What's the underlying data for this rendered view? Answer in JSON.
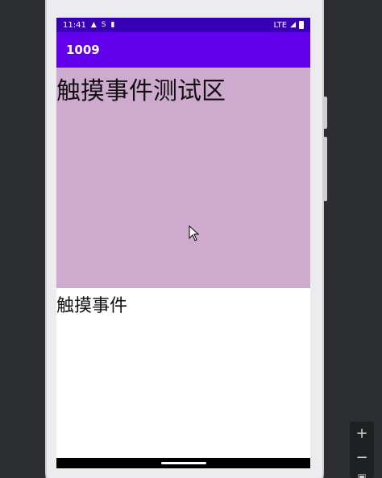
{
  "status_bar": {
    "time": "11:41",
    "network": "LTE",
    "icons": [
      "notification-a-icon",
      "notification-s-icon",
      "sd-card-icon",
      "signal-icon",
      "battery-icon"
    ]
  },
  "app_bar": {
    "title": "1009"
  },
  "touch_area": {
    "label": "触摸事件测试区",
    "background": "#ceabce"
  },
  "event_text": {
    "label": "触摸事件"
  },
  "colors": {
    "status_bar": "#3700b3",
    "app_bar": "#6200ee"
  },
  "emulator_controls": {
    "zoom_in": "+",
    "zoom_out": "−"
  }
}
